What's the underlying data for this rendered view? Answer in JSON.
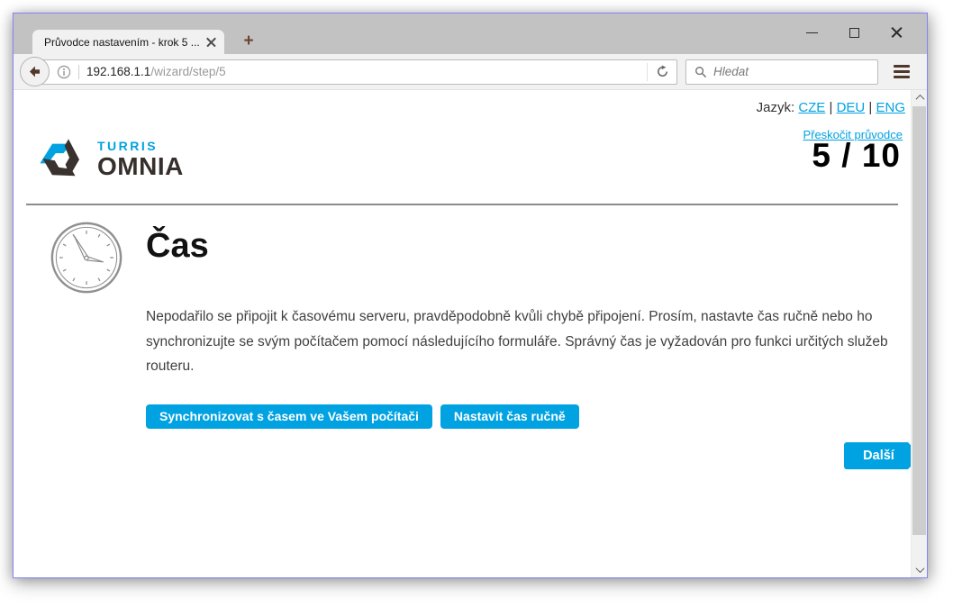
{
  "browser": {
    "tab_title": "Průvodce nastavením - krok 5 ...",
    "new_tab_glyph": "+",
    "url": {
      "host": "192.168.1.1",
      "path": "/wizard/step/5"
    },
    "search_placeholder": "Hledat"
  },
  "icons": {
    "minimize": "thin-horizontal-bar",
    "maximize": "hollow-square",
    "close": "thin-x",
    "tab_close": "thin-x",
    "back": "left-arrow-in-circle",
    "info": "circled-i",
    "reload": "circular-arrow",
    "search": "magnifier",
    "menu": "hamburger-three-bars",
    "scroll_up": "chevron-up",
    "scroll_down": "chevron-down",
    "clock": "analog-clock-line-drawing",
    "logo": "turris-triskelion-knot"
  },
  "page": {
    "language": {
      "label": "Jazyk:",
      "separator": "|",
      "options": [
        "CZE",
        "DEU",
        "ENG"
      ]
    },
    "skip_link": "Přeskočit průvodce",
    "step_indicator": "5 / 10",
    "logo": {
      "brand_top": "TURRIS",
      "brand_bottom": "OMNIA"
    },
    "heading": "Čas",
    "description": "Nepodařilo se připojit k časovému serveru, pravděpodobně kvůli chybě připojení. Prosím, nastavte čas ručně nebo ho synchronizujte se svým počítačem pomocí následujícího formuláře. Správný čas je vyžadován pro funkci určitých služeb routeru.",
    "buttons": {
      "sync": "Synchronizovat s časem ve Vašem počítači",
      "manual": "Nastavit čas ručně"
    },
    "next_button": "Další",
    "colors": {
      "accent_blue": "#00a2e2",
      "logo_dark": "#3a322e"
    }
  }
}
